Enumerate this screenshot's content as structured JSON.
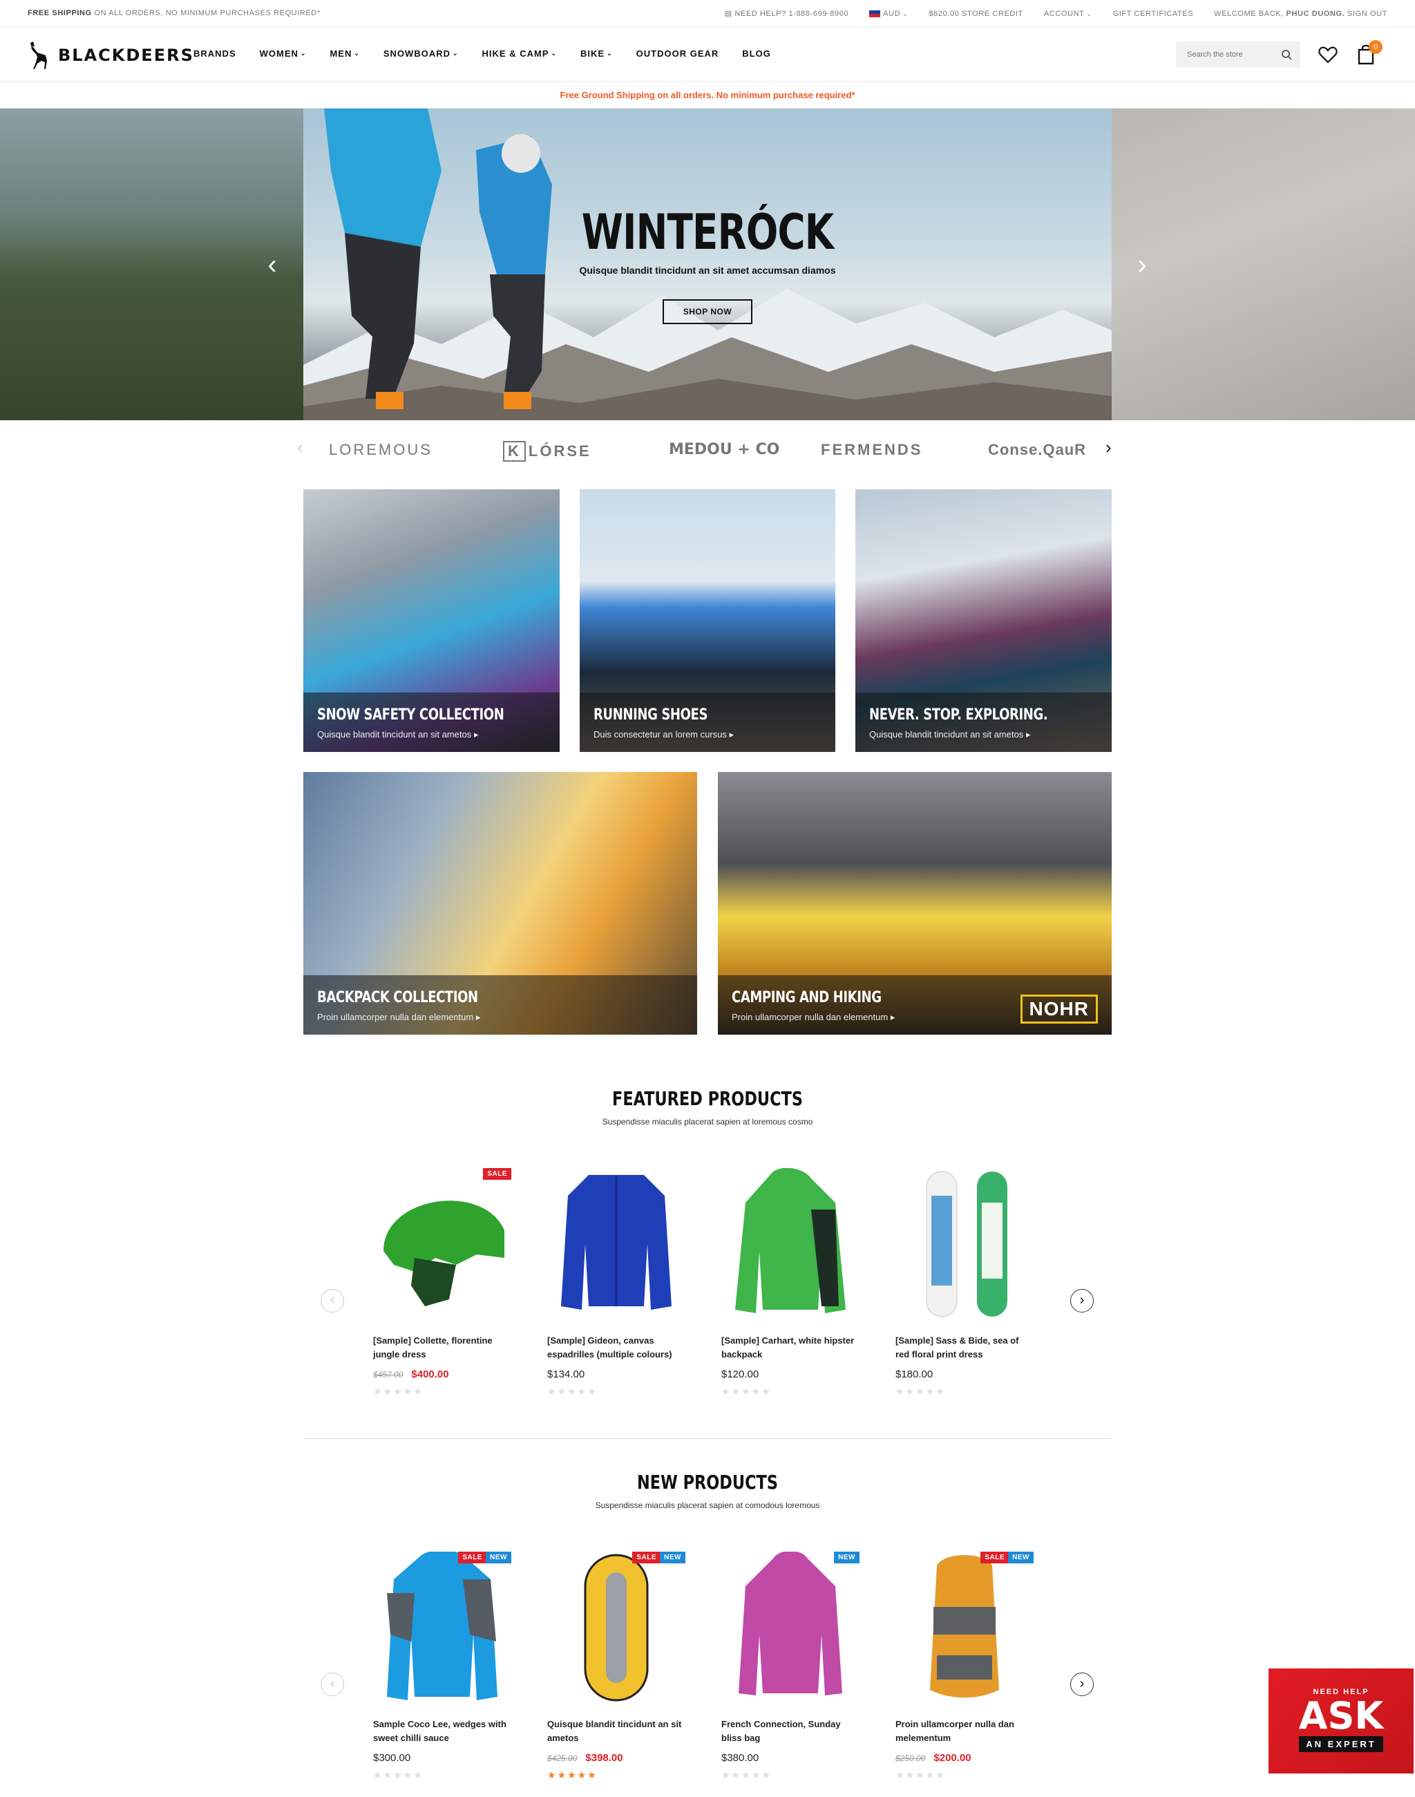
{
  "topbar": {
    "shipping_bold": "FREE SHIPPING",
    "shipping_rest": "ON ALL ORDERS. NO MINIMUM PURCHASES REQUIRED*",
    "help": "NEED HELP? 1-888-699-8900",
    "currency": "AUD",
    "credit": "$620.00 STORE CREDIT",
    "account": "ACCOUNT",
    "gift": "GIFT CERTIFICATES",
    "welcome": "WELCOME BACK,",
    "user": "PHUC DUONG.",
    "signout": "SIGN OUT"
  },
  "header": {
    "logo": "BLACKDEERS",
    "nav": [
      {
        "label": "BRANDS",
        "dropdown": false
      },
      {
        "label": "WOMEN",
        "dropdown": true
      },
      {
        "label": "MEN",
        "dropdown": true
      },
      {
        "label": "SNOWBOARD",
        "dropdown": true
      },
      {
        "label": "HIKE & CAMP",
        "dropdown": true
      },
      {
        "label": "BIKE",
        "dropdown": true
      },
      {
        "label": "OUTDOOR GEAR",
        "dropdown": false
      },
      {
        "label": "BLOG",
        "dropdown": false
      }
    ],
    "search_placeholder": "Search the store",
    "cart_count": "0"
  },
  "ship_banner": "Free Ground Shipping on all orders. No minimum purchase required*",
  "hero": {
    "title": "WINTERÓCK",
    "subtitle": "Quisque blandit tincidunt an sit amet accumsan diamos",
    "button": "SHOP NOW"
  },
  "brands": [
    "LOREMOUS",
    "LÓRSE",
    "MEDOU + CO",
    "FERMENDS",
    "Conse.QauR"
  ],
  "tiles": [
    {
      "title": "SNOW SAFETY COLLECTION",
      "sub": "Quisque blandit tincidunt an sit ametos"
    },
    {
      "title": "RUNNING SHOES",
      "sub": "Duis consectetur an lorem cursus"
    },
    {
      "title": "NEVER. STOP. EXPLORING.",
      "sub": "Quisque blandit tincidunt an sit ametos"
    },
    {
      "title": "BACKPACK COLLECTION",
      "sub": "Proin ullamcorper nulla dan elementum"
    },
    {
      "title": "CAMPING AND HIKING",
      "sub": "Proin ullamcorper nulla dan elementum",
      "brand": "NOHR"
    }
  ],
  "featured": {
    "title": "FEATURED PRODUCTS",
    "sub": "Suspendisse miaculis placerat sapien at loremous cosmo",
    "products": [
      {
        "name": "[Sample] Collette, florentine jungle dress",
        "old": "$457.00",
        "price": "$400.00",
        "badges": [
          "SALE"
        ],
        "rating": 0
      },
      {
        "name": "[Sample] Gideon, canvas espadrilles (multiple colours)",
        "old": "",
        "price": "$134.00",
        "badges": [],
        "rating": 0
      },
      {
        "name": "[Sample] Carhart, white hipster backpack",
        "old": "",
        "price": "$120.00",
        "badges": [],
        "rating": 0
      },
      {
        "name": "[Sample] Sass & Bide, sea of red floral print dress",
        "old": "",
        "price": "$180.00",
        "badges": [],
        "rating": 0
      }
    ]
  },
  "newprod": {
    "title": "NEW PRODUCTS",
    "sub": "Suspendisse miaculis placerat sapien at comodous loremous",
    "products": [
      {
        "name": "Sample Coco Lee, wedges with sweet chilli sauce",
        "old": "",
        "price": "$300.00",
        "badges": [
          "SALE",
          "NEW"
        ],
        "rating": 0
      },
      {
        "name": "Quisque blandit tincidunt an sit ametos",
        "old": "$425.00",
        "price": "$398.00",
        "badges": [
          "SALE",
          "NEW"
        ],
        "rating": 5
      },
      {
        "name": "French Connection, Sunday bliss bag",
        "old": "",
        "price": "$380.00",
        "badges": [
          "NEW"
        ],
        "rating": 0
      },
      {
        "name": "Proin ullamcorper nulla dan melementum",
        "old": "$250.00",
        "price": "$200.00",
        "badges": [
          "SALE",
          "NEW"
        ],
        "rating": 0
      }
    ]
  },
  "expert": {
    "line1": "NEED HELP",
    "line2": "ASK",
    "line3": "AN EXPERT"
  },
  "colors": {
    "accent": "#f58220",
    "sale": "#e0202a",
    "new": "#1e8ad6"
  }
}
